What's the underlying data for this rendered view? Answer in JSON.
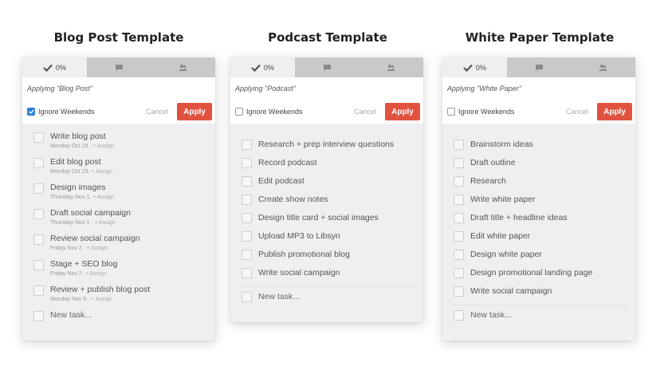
{
  "templates": [
    {
      "heading": "Blog Post Template",
      "progress": "0%",
      "applying": "Applying \"Blog Post\"",
      "ignore_weekends": "Ignore Weekends",
      "ignore_checked": true,
      "cancel": "Cancel",
      "apply": "Apply",
      "tasks": [
        {
          "name": "Write blog post",
          "date": "Monday Oct 29",
          "assign": "+ Assign"
        },
        {
          "name": "Edit blog post",
          "date": "Monday Oct 29",
          "assign": "+ Assign"
        },
        {
          "name": "Design images",
          "date": "Thursday Nov 1",
          "assign": "+ Assign"
        },
        {
          "name": "Draft social campaign",
          "date": "Thursday Nov 1",
          "assign": "+ Assign"
        },
        {
          "name": "Review social campaign",
          "date": "Friday Nov 2",
          "assign": "+ Assign"
        },
        {
          "name": "Stage + SEO blog",
          "date": "Friday Nov 2",
          "assign": "+ Assign"
        },
        {
          "name": "Review + publish blog post",
          "date": "Monday Nov 5",
          "assign": "+ Assign"
        }
      ],
      "new_task": "New task..."
    },
    {
      "heading": "Podcast Template",
      "progress": "0%",
      "applying": "Applying \"Podcast\"",
      "ignore_weekends": "Ignore Weekends",
      "ignore_checked": false,
      "cancel": "Cancel",
      "apply": "Apply",
      "tasks": [
        {
          "name": "Research + prep interview questions"
        },
        {
          "name": "Record podcast"
        },
        {
          "name": "Edit podcast"
        },
        {
          "name": "Create show notes"
        },
        {
          "name": "Design title card + social images"
        },
        {
          "name": "Upload MP3 to Libsyn"
        },
        {
          "name": "Publish promotional blog"
        },
        {
          "name": "Write social campaign"
        }
      ],
      "new_task": "New task..."
    },
    {
      "heading": "White Paper Template",
      "progress": "0%",
      "applying": "Applying \"White Paper\"",
      "ignore_weekends": "Ignore Weekends",
      "ignore_checked": false,
      "cancel": "Cancel",
      "apply": "Apply",
      "tasks": [
        {
          "name": "Brainstorm ideas"
        },
        {
          "name": "Draft outline"
        },
        {
          "name": "Research"
        },
        {
          "name": "Write white paper"
        },
        {
          "name": "Draft title + headline ideas"
        },
        {
          "name": "Edit white paper"
        },
        {
          "name": "Design white paper"
        },
        {
          "name": "Design promotional landing page"
        },
        {
          "name": "Write social campaign"
        }
      ],
      "new_task": "New task..."
    }
  ],
  "icons": {
    "tab_1": "checkmark-icon",
    "tab_2": "speech-bubble-icon",
    "tab_3": "people-icon"
  },
  "colors": {
    "apply_button": "#e0523f",
    "checkbox_checked": "#2f7fd3",
    "tab_bar": "#c9c9c9"
  }
}
